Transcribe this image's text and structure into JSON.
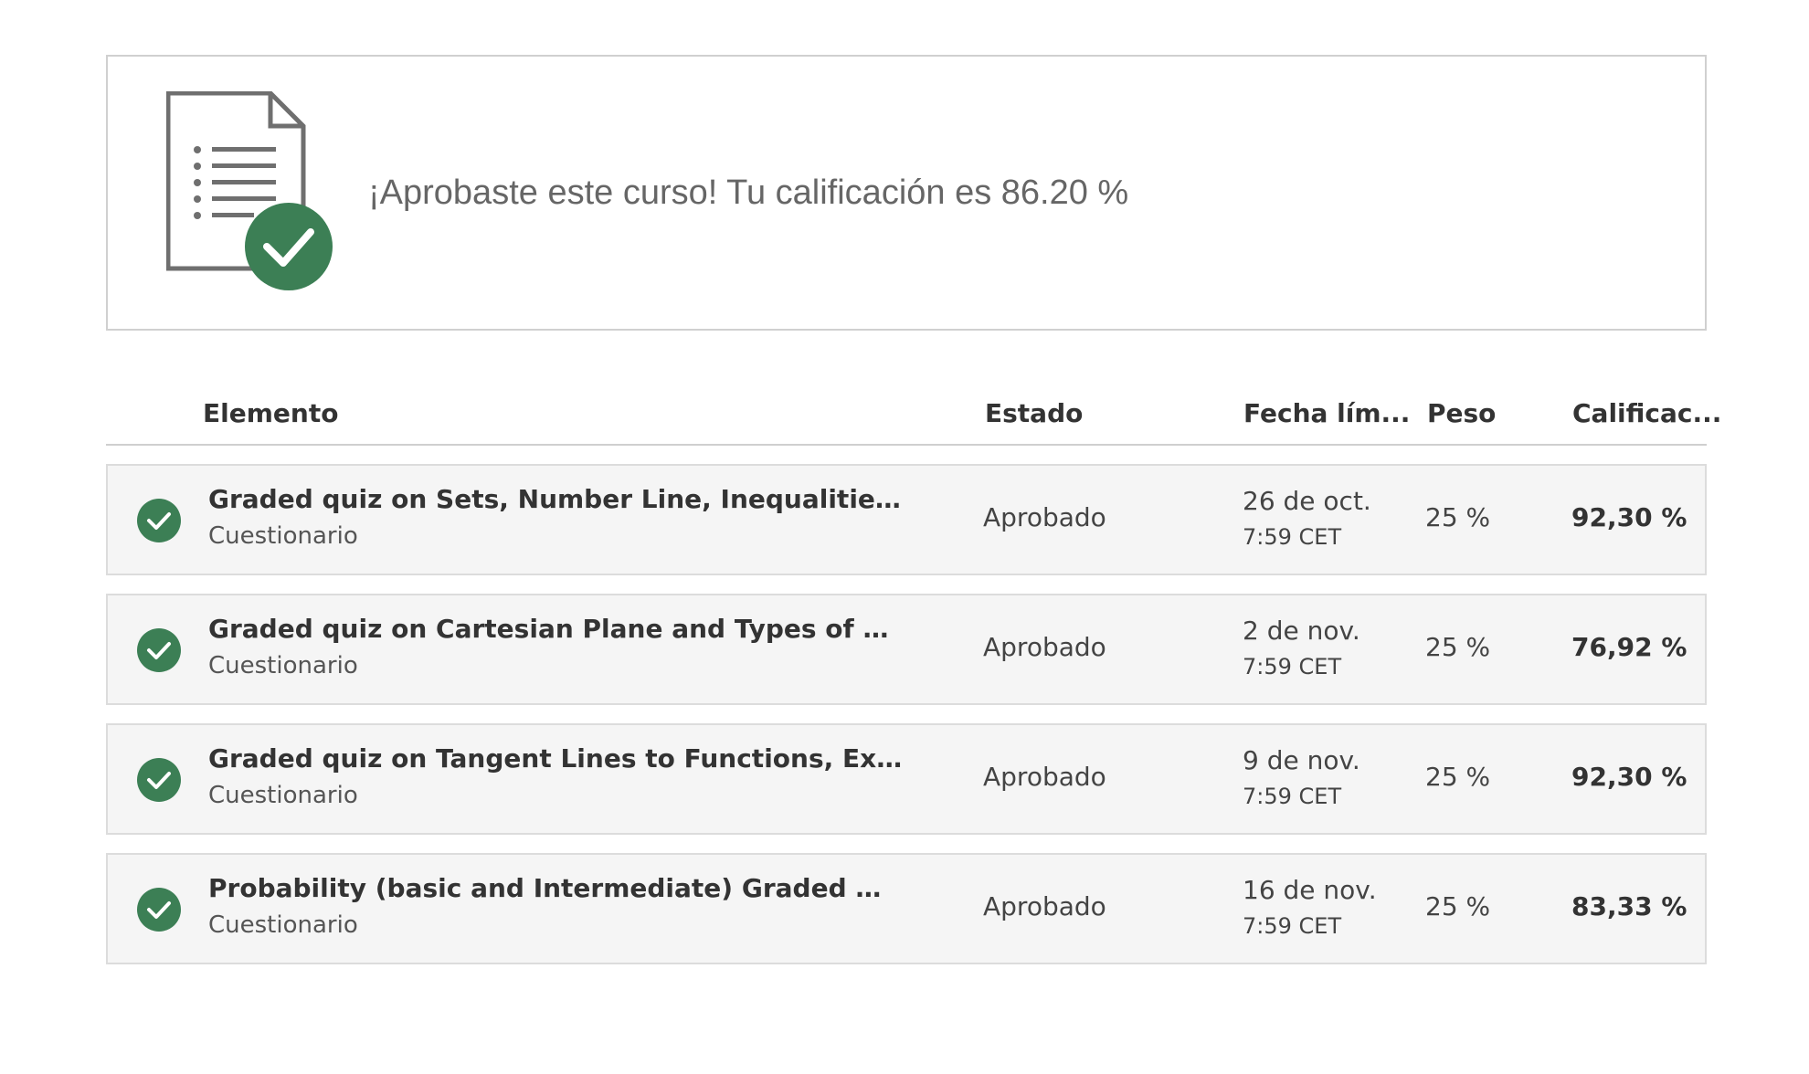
{
  "banner": {
    "icon": "document-check-icon",
    "message": "¡Aprobaste este curso! Tu calificación es 86.20 %"
  },
  "colors": {
    "success": "#3c7f55",
    "border": "#d0d0d0",
    "row_background": "#f5f5f5",
    "banner_text": "#666666"
  },
  "table": {
    "headers": {
      "item": "Elemento",
      "status": "Estado",
      "due_date": "Fecha lím...",
      "weight": "Peso",
      "grade": "Calificac..."
    },
    "rows": [
      {
        "status_icon": "check-circle-icon",
        "title": "Graded quiz on Sets, Number Line, Inequalities, Si...",
        "type": "Cuestionario",
        "status": "Aprobado",
        "due_date": "26 de oct.",
        "due_time": "7:59 CET",
        "weight": "25 %",
        "grade": "92,30 %"
      },
      {
        "status_icon": "check-circle-icon",
        "title": "Graded quiz on Cartesian Plane and Types of Funct...",
        "type": "Cuestionario",
        "status": "Aprobado",
        "due_date": "2 de nov.",
        "due_time": "7:59 CET",
        "weight": "25 %",
        "grade": "76,92 %"
      },
      {
        "status_icon": "check-circle-icon",
        "title": "Graded quiz on Tangent Lines to Functions, Expone...",
        "type": "Cuestionario",
        "status": "Aprobado",
        "due_date": "9 de nov.",
        "due_time": "7:59 CET",
        "weight": "25 %",
        "grade": "92,30 %"
      },
      {
        "status_icon": "check-circle-icon",
        "title": "Probability (basic and Intermediate) Graded Quiz",
        "type": "Cuestionario",
        "status": "Aprobado",
        "due_date": "16 de nov.",
        "due_time": "7:59 CET",
        "weight": "25 %",
        "grade": "83,33 %"
      }
    ]
  }
}
